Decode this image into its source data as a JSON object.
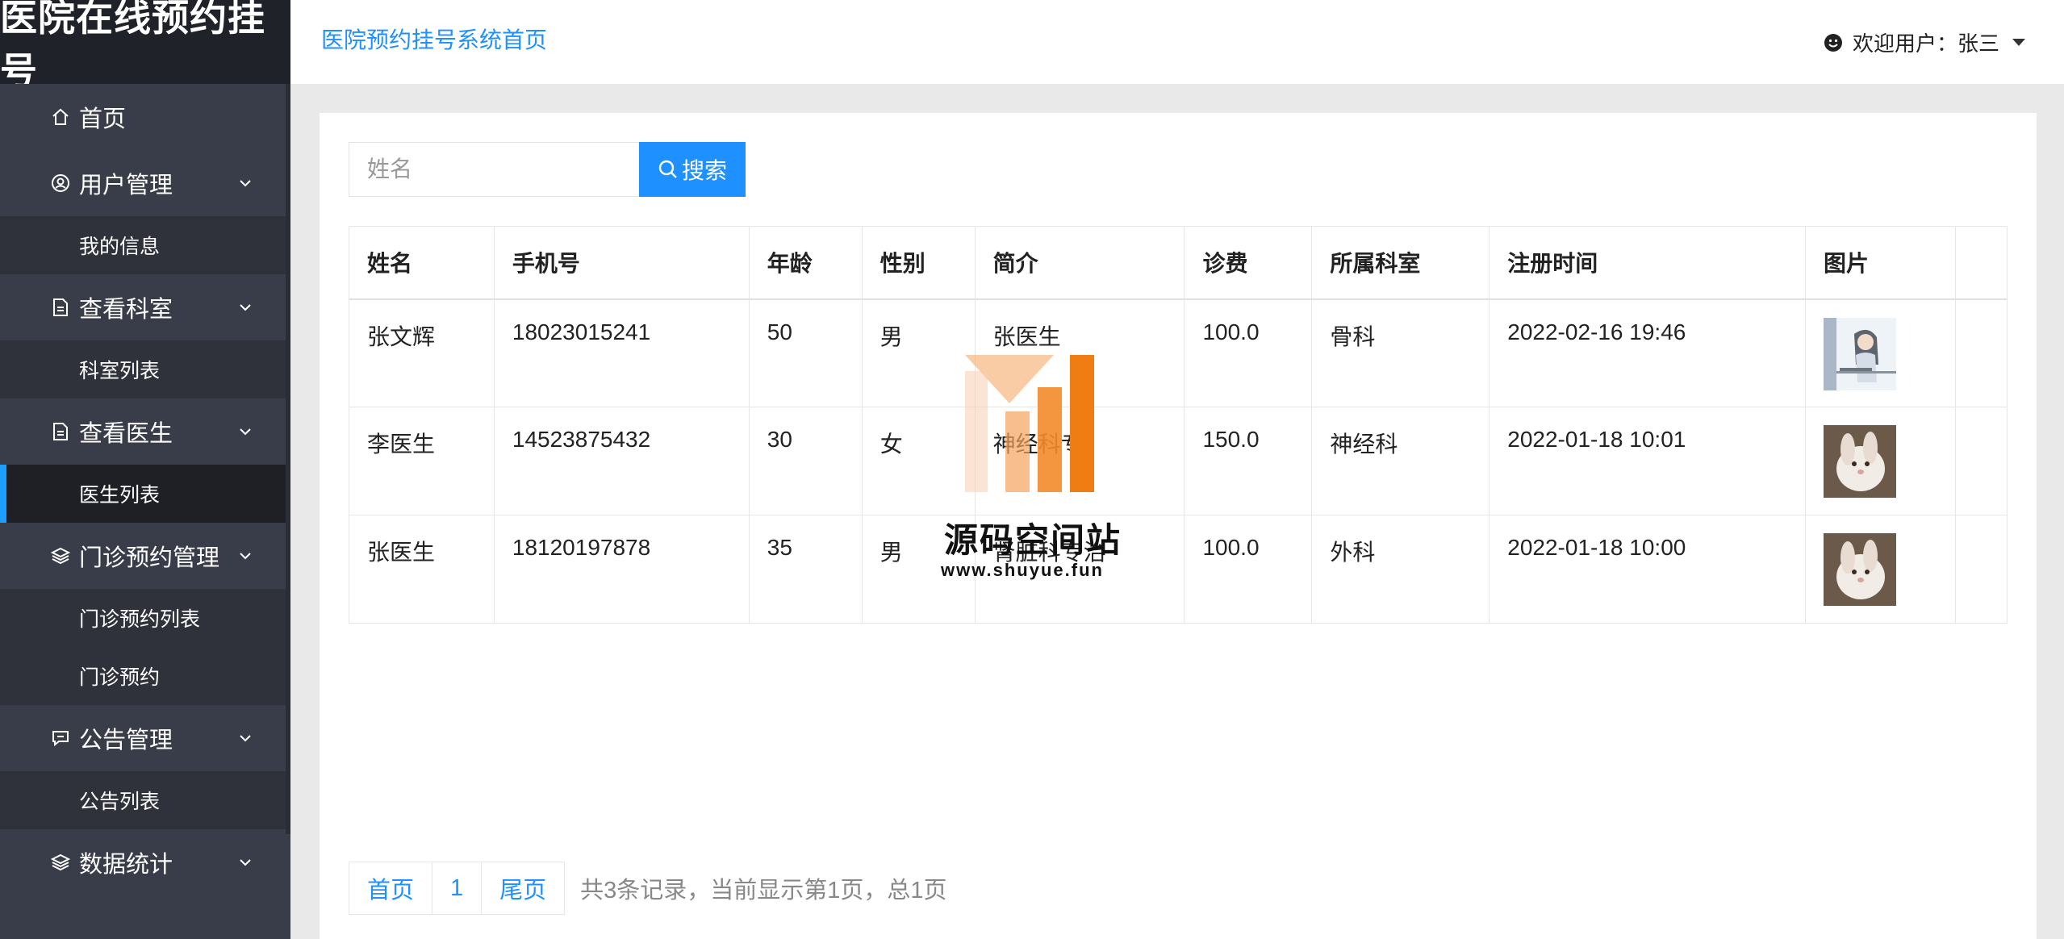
{
  "app": {
    "brand": "医院在线预约挂号"
  },
  "header": {
    "breadcrumb": "医院预约挂号系统首页",
    "user_label": "欢迎用户：张三"
  },
  "sidebar": {
    "items": [
      {
        "label": "首页",
        "icon": "home-icon"
      },
      {
        "label": "用户管理",
        "icon": "user-circle-icon",
        "children": [
          "我的信息"
        ]
      },
      {
        "label": "查看科室",
        "icon": "document-icon",
        "children": [
          "科室列表"
        ]
      },
      {
        "label": "查看医生",
        "icon": "document-icon",
        "children": [
          "医生列表"
        ]
      },
      {
        "label": "门诊预约管理",
        "icon": "layers-icon",
        "children": [
          "门诊预约列表",
          "门诊预约"
        ]
      },
      {
        "label": "公告管理",
        "icon": "announcement-icon",
        "children": [
          "公告列表"
        ]
      },
      {
        "label": "数据统计",
        "icon": "layers-icon"
      }
    ],
    "active_child": "医生列表"
  },
  "search": {
    "placeholder": "姓名",
    "button_label": "搜索"
  },
  "table": {
    "columns": [
      "姓名",
      "手机号",
      "年龄",
      "性别",
      "简介",
      "诊费",
      "所属科室",
      "注册时间",
      "图片"
    ],
    "rows": [
      {
        "name": "张文辉",
        "phone": "18023015241",
        "age": "50",
        "gender": "男",
        "intro": "张医生",
        "fee": "100.0",
        "dept": "骨科",
        "time": "2022-02-16 19:46",
        "image": "doctor-illustration"
      },
      {
        "name": "李医生",
        "phone": "14523875432",
        "age": "30",
        "gender": "女",
        "intro": "神经科专",
        "fee": "150.0",
        "dept": "神经科",
        "time": "2022-01-18 10:01",
        "image": "rabbit-photo"
      },
      {
        "name": "张医生",
        "phone": "18120197878",
        "age": "35",
        "gender": "男",
        "intro": "肾脏科专治",
        "fee": "100.0",
        "dept": "外科",
        "time": "2022-01-18 10:00",
        "image": "rabbit-photo"
      }
    ]
  },
  "pager": {
    "first": "首页",
    "page": "1",
    "last": "尾页",
    "info": "共3条记录，当前显示第1页，总1页"
  },
  "watermark": {
    "title": "源码空间站",
    "url": "www.shuyue.fun"
  },
  "colors": {
    "accent": "#1e90ff",
    "sidebar_bg": "#393d49",
    "brand_bg": "#20222a"
  }
}
